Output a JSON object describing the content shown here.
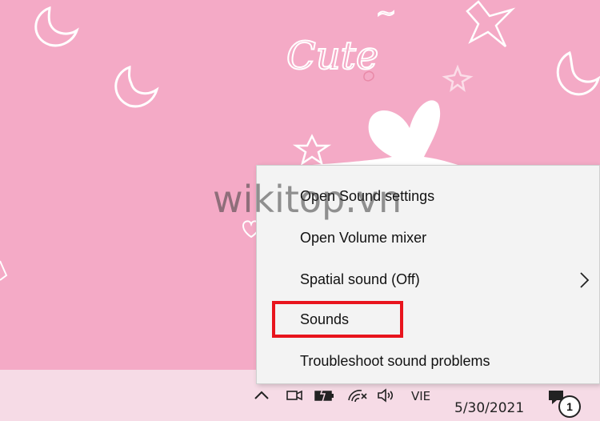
{
  "wallpaper": {
    "text": "Cute",
    "background_color": "#f4aac6"
  },
  "watermark": {
    "text": "wikitop.vn"
  },
  "context_menu": {
    "items": [
      {
        "label": "Open Sound settings"
      },
      {
        "label": "Open Volume mixer"
      },
      {
        "label": "Spatial sound (Off)",
        "has_submenu": true
      },
      {
        "label": "Sounds",
        "highlighted": true
      },
      {
        "label": "Troubleshoot sound problems"
      }
    ],
    "highlight_color": "#e8141d"
  },
  "taskbar": {
    "language": "VIE",
    "date": "5/30/2021",
    "notification_count": "1",
    "icons": [
      "chevron-up-icon",
      "meet-now-icon",
      "battery-icon",
      "wifi-icon",
      "speaker-icon",
      "notification-icon"
    ]
  }
}
